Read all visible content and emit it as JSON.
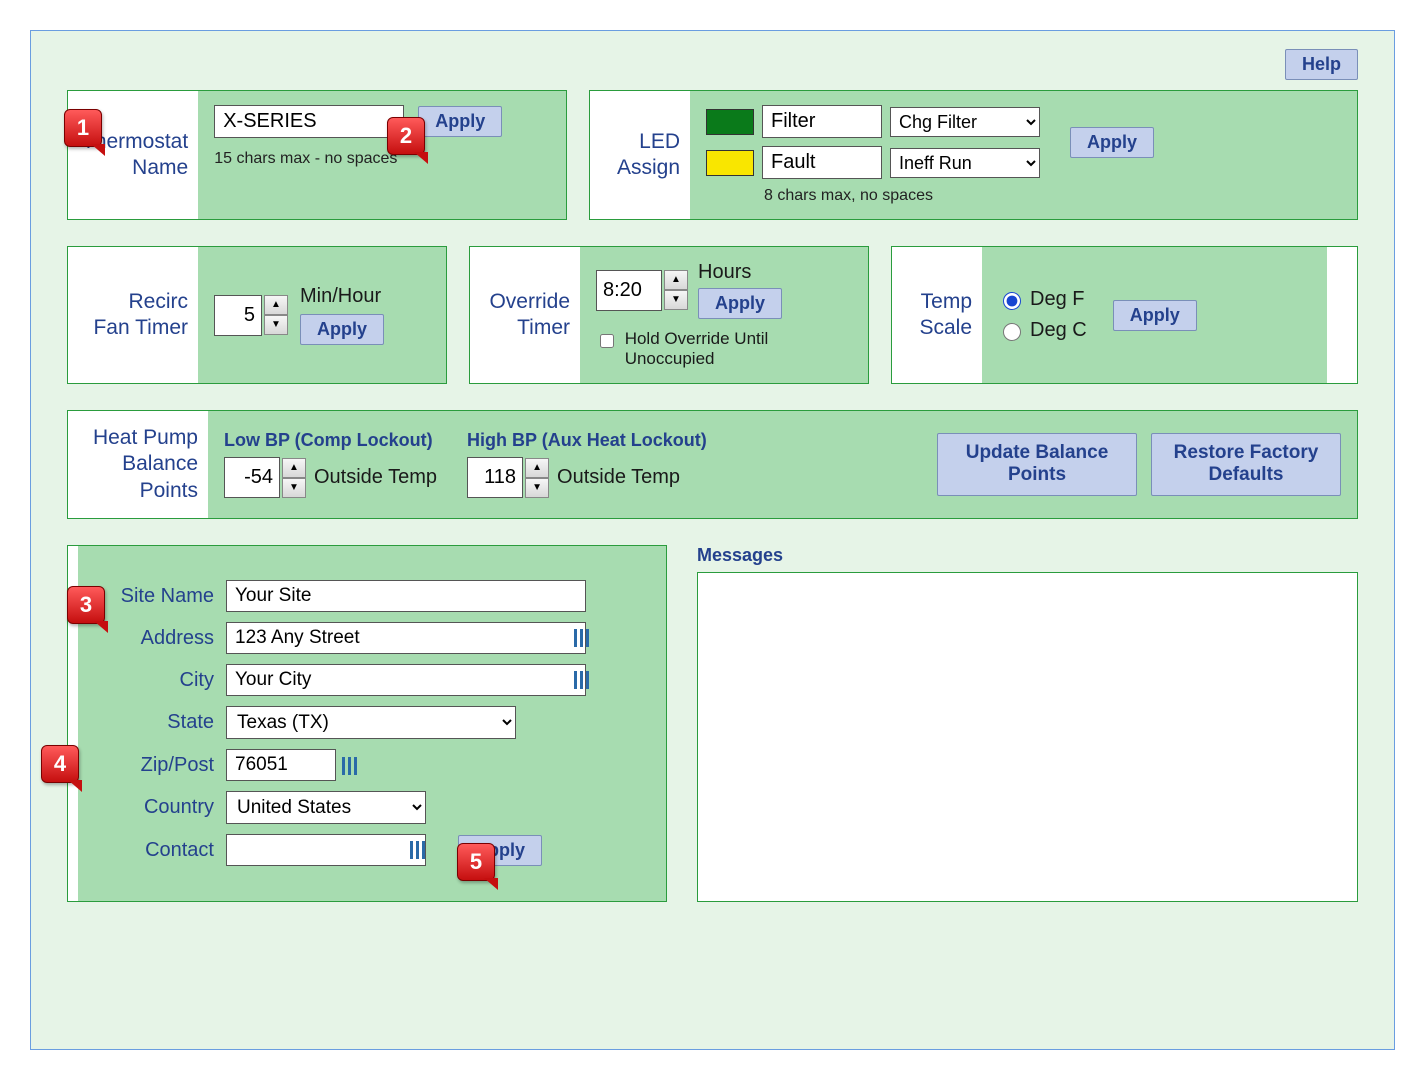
{
  "help": "Help",
  "markers": {
    "m1": "1",
    "m2": "2",
    "m3": "3",
    "m4": "4",
    "m5": "5"
  },
  "thermostat": {
    "label_line1": "Thermostat",
    "label_line2": "Name",
    "value": "X-SERIES",
    "hint": "15 chars max - no spaces",
    "apply": "Apply"
  },
  "led": {
    "label_line1": "LED",
    "label_line2": "Assign",
    "row1": {
      "name": "Filter",
      "action": "Chg Filter"
    },
    "row2": {
      "name": "Fault",
      "action": "Ineff Run"
    },
    "hint": "8 chars max, no spaces",
    "apply": "Apply"
  },
  "recirc": {
    "label_line1": "Recirc",
    "label_line2": "Fan Timer",
    "value": "5",
    "unit": "Min/Hour",
    "apply": "Apply"
  },
  "override": {
    "label_line1": "Override",
    "label_line2": "Timer",
    "value": "8:20",
    "unit": "Hours",
    "hold_label": "Hold Override Until Unoccupied",
    "apply": "Apply"
  },
  "tempscale": {
    "label_line1": "Temp",
    "label_line2": "Scale",
    "f": "Deg F",
    "c": "Deg C",
    "selected": "f",
    "apply": "Apply"
  },
  "balance": {
    "label_line1": "Heat Pump",
    "label_line2": "Balance",
    "label_line3": "Points",
    "low_title": "Low BP (Comp Lockout)",
    "low_value": "-54",
    "low_unit": "Outside Temp",
    "high_title": "High BP (Aux Heat Lockout)",
    "high_value": "118",
    "high_unit": "Outside Temp",
    "update_btn": "Update Balance Points",
    "restore_btn": "Restore Factory Defaults"
  },
  "site": {
    "label_sitename": "Site Name",
    "sitename": "Your Site",
    "label_address": "Address",
    "address": "123 Any Street",
    "label_city": "City",
    "city": "Your City",
    "label_state": "State",
    "state": "Texas (TX)",
    "label_zip": "Zip/Post",
    "zip": "76051",
    "label_country": "Country",
    "country": "United States",
    "label_contact": "Contact",
    "contact": "",
    "apply": "Apply"
  },
  "messages": {
    "title": "Messages"
  }
}
